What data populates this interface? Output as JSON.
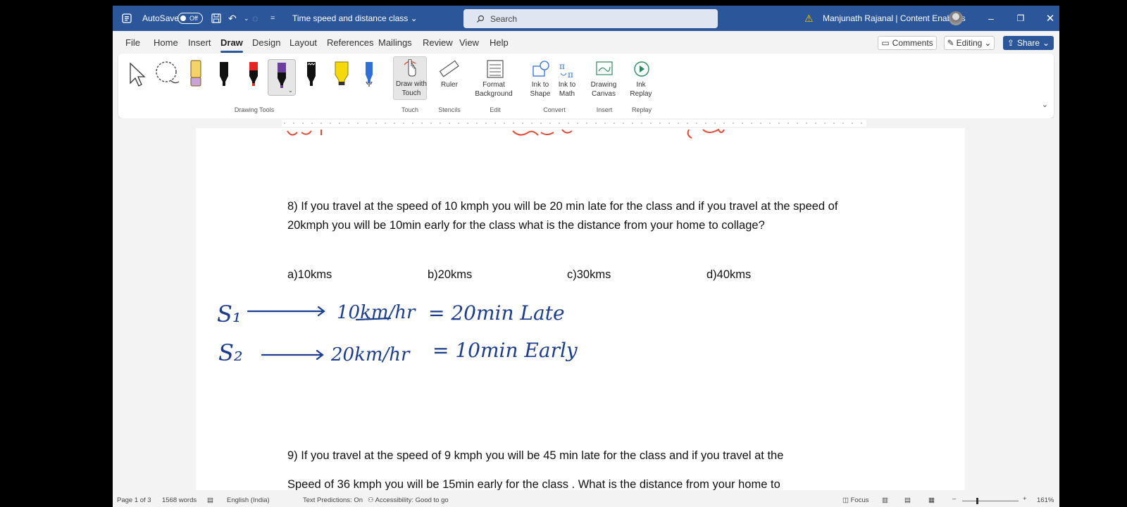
{
  "titlebar": {
    "autosave_label": "AutoSave",
    "autosave_state": "Off",
    "doc_title": "Time speed and distance class",
    "search_placeholder": "Search",
    "user_name": "Manjunath Rajanal | Content Enablers"
  },
  "menu": {
    "tabs": [
      "File",
      "Home",
      "Insert",
      "Draw",
      "Design",
      "Layout",
      "References",
      "Mailings",
      "Review",
      "View",
      "Help"
    ],
    "active_tab": "Draw",
    "comments_label": "Comments",
    "editing_label": "Editing",
    "share_label": "Share"
  },
  "ribbon": {
    "groups": {
      "drawing_tools": "Drawing Tools",
      "touch": "Touch",
      "stencils": "Stencils",
      "edit": "Edit",
      "convert": "Convert",
      "insert": "Insert",
      "replay": "Replay"
    },
    "buttons": {
      "draw_with_touch": "Draw with Touch",
      "ruler": "Ruler",
      "format_background": "Format Background",
      "ink_to_shape": "Ink to Shape",
      "ink_to_math": "Ink to Math",
      "drawing_canvas": "Drawing Canvas",
      "ink_replay": "Ink Replay"
    },
    "pen_colors": [
      "#111111",
      "#e52424",
      "#6b3fa0",
      "#111111",
      "#f5d90a",
      "#2f6fd6"
    ]
  },
  "document": {
    "q8_text": "8) If you travel at the speed of 10 kmph you will be 20 min late for the class and if you travel at the speed of 20kmph you will be 10min early for the class what is the distance from your home to collage?",
    "q8_options": [
      "a)10kms",
      "b)20kms",
      "c)30kms",
      "d)40kms"
    ],
    "q9_line1": "9) If you travel at the speed of 9 kmph you will be 45 min late for the class and if you travel at the",
    "q9_line2": "Speed of 36 kmph you will be 15min early for the class . What is the distance from your home to",
    "handwriting": {
      "s1_label": "S₁",
      "s1_speed": "10km/hr",
      "s1_result": "= 20min Late",
      "s2_label": "S₂",
      "s2_speed": "20km/hr",
      "s2_result": "= 10min Early",
      "ink_color": "#1c3c8c"
    }
  },
  "status": {
    "page": "Page 1 of 3",
    "words": "1568 words",
    "language": "English (India)",
    "text_predictions": "Text Predictions: On",
    "accessibility": "Accessibility: Good to go",
    "focus": "Focus",
    "zoom": "161%"
  }
}
